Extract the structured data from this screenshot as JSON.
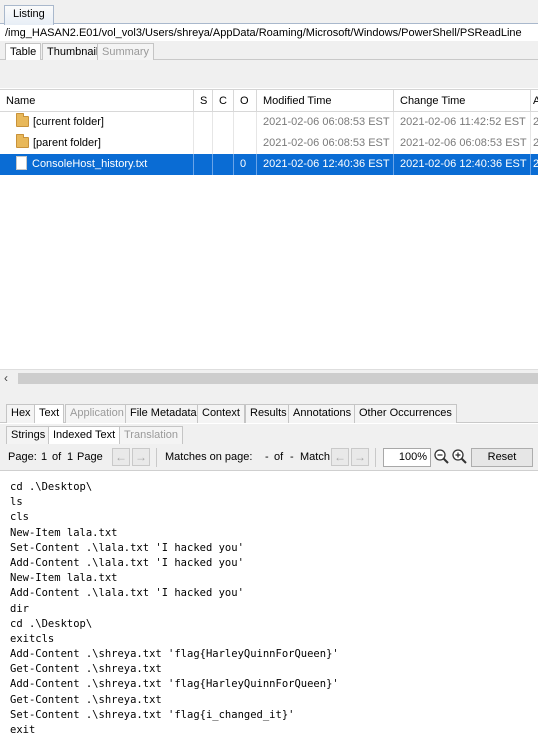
{
  "listing": {
    "tab_label": "Listing",
    "path": "/img_HASAN2.E01/vol_vol3/Users/shreya/AppData/Roaming/Microsoft/Windows/PowerShell/PSReadLine"
  },
  "result_tabs": [
    {
      "label": "Table",
      "state": "active"
    },
    {
      "label": "Thumbnail",
      "state": "normal"
    },
    {
      "label": "Summary",
      "state": "disabled"
    }
  ],
  "table": {
    "columns": [
      "Name",
      "S",
      "C",
      "O",
      "Modified Time",
      "Change Time",
      "A"
    ],
    "rows": [
      {
        "icon": "folder-icon",
        "name": "[current folder]",
        "s": "",
        "c": "",
        "o": "",
        "modified": "2021-02-06 06:08:53 EST",
        "change": "2021-02-06 11:42:52 EST",
        "a": "2",
        "selected": false
      },
      {
        "icon": "folder-icon",
        "name": "[parent folder]",
        "s": "",
        "c": "",
        "o": "",
        "modified": "2021-02-06 06:08:53 EST",
        "change": "2021-02-06 06:08:53 EST",
        "a": "2",
        "selected": false
      },
      {
        "icon": "file-icon",
        "name": "ConsoleHost_history.txt",
        "s": "",
        "c": "",
        "o": "0",
        "modified": "2021-02-06 12:40:36 EST",
        "change": "2021-02-06 12:40:36 EST",
        "a": "2",
        "selected": true
      }
    ]
  },
  "viewer_tabs": [
    {
      "label": "Hex",
      "state": "normal"
    },
    {
      "label": "Text",
      "state": "active"
    },
    {
      "label": "Application",
      "state": "disabled"
    },
    {
      "label": "File Metadata",
      "state": "normal"
    },
    {
      "label": "Context",
      "state": "normal"
    },
    {
      "label": "Results",
      "state": "normal"
    },
    {
      "label": "Annotations",
      "state": "normal"
    },
    {
      "label": "Other Occurrences",
      "state": "normal"
    }
  ],
  "text_tabs": [
    {
      "label": "Strings",
      "state": "normal"
    },
    {
      "label": "Indexed Text",
      "state": "active"
    },
    {
      "label": "Translation",
      "state": "disabled"
    }
  ],
  "pager": {
    "page_label": "Page:",
    "page_current": "1",
    "of_label": "of",
    "page_total": "1",
    "page_word": "Page",
    "matches_label": "Matches on page:",
    "matches_current": "-",
    "matches_of": "of",
    "matches_total": "-",
    "match_word": "Match",
    "zoom": "100%",
    "reset_label": "Reset"
  },
  "text_lines": [
    "cd .\\Desktop\\",
    "ls",
    "cls",
    "New-Item lala.txt",
    "Set-Content .\\lala.txt 'I hacked you'",
    "Add-Content .\\lala.txt 'I hacked you'",
    "New-Item lala.txt",
    "Add-Content .\\lala.txt 'I hacked you'",
    "dir",
    "cd .\\Desktop\\",
    "exitcls",
    "Add-Content .\\shreya.txt 'flag{HarleyQuinnForQueen}'",
    "Get-Content .\\shreya.txt",
    "Add-Content .\\shreya.txt 'flag{HarleyQuinnForQueen}'",
    "Get-Content .\\shreya.txt",
    "Set-Content .\\shreya.txt 'flag{i_changed_it}'",
    "exit"
  ]
}
